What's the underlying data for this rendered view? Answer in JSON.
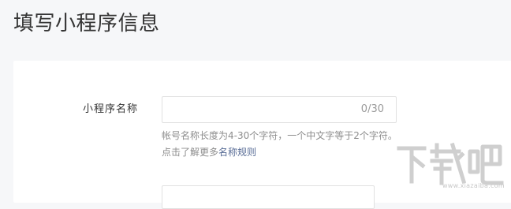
{
  "page": {
    "title": "填写小程序信息"
  },
  "form": {
    "name_field": {
      "label": "小程序名称",
      "value": "",
      "counter": "0/30"
    },
    "hint": {
      "text": "帐号名称长度为4-30个字符，一个中文字等于2个字符。点击了解更多",
      "link_label": "名称规则"
    }
  },
  "watermark": {
    "logo": "下载吧",
    "url": "www.xiazaiba.com"
  },
  "colors": {
    "background": "#f6f7f9",
    "card": "#ffffff",
    "link": "#576b95",
    "hint_text": "#8d8d8d"
  }
}
